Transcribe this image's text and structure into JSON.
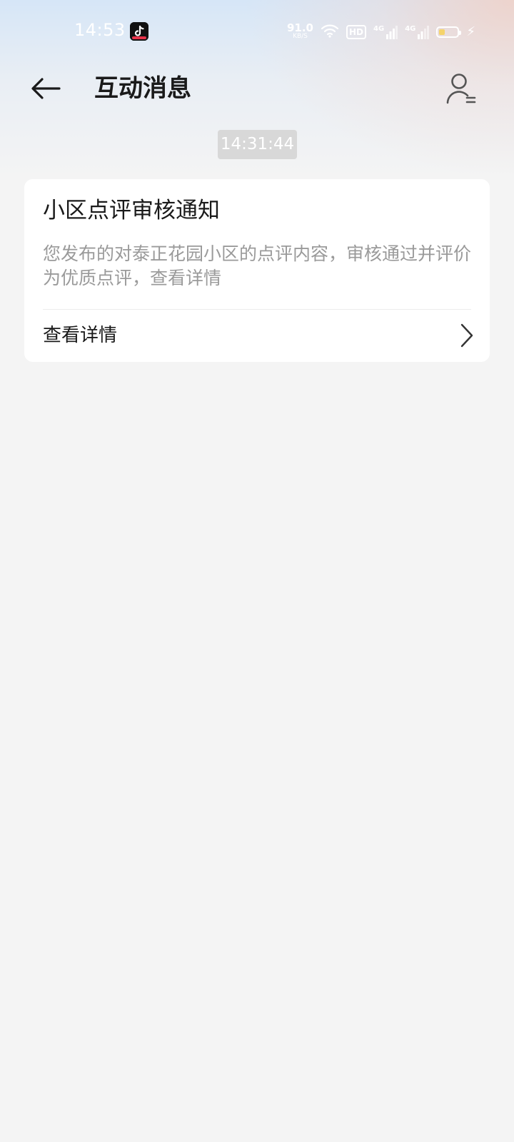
{
  "status_bar": {
    "time": "14:53",
    "net_speed_value": "91.0",
    "net_speed_unit": "KB/S",
    "hd_label": "HD",
    "signal_label_1": "4G",
    "signal_label_2": "4G",
    "battery_level": 0.3,
    "battery_fill_color": "#f5d36b",
    "icons": [
      "tiktok-icon",
      "wifi-icon",
      "hd-icon",
      "signal-4g-icon",
      "signal-4g-icon",
      "battery-icon",
      "charging-bolt-icon"
    ]
  },
  "header": {
    "title": "互动消息",
    "back_icon": "arrow-left-icon",
    "profile_icon": "user-list-icon"
  },
  "messages": [
    {
      "timestamp": "14:31:44",
      "title": "小区点评审核通知",
      "body": "您发布的对泰正花园小区的点评内容，审核通过并评价为优质点评，查看详情",
      "action_label": "查看详情",
      "action_icon": "chevron-right-icon"
    }
  ],
  "colors": {
    "background": "#f4f4f4",
    "card": "#ffffff",
    "timestamp_chip": "#d8d8d8",
    "title_text": "#1a1a1a",
    "body_text": "#9a9a9a"
  }
}
